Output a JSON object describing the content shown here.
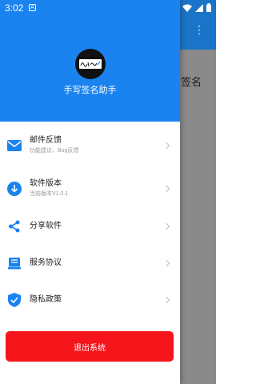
{
  "status_bar": {
    "time": "3:02",
    "app_icon": "A"
  },
  "background": {
    "title": "签名"
  },
  "drawer": {
    "app_name": "手写签名助手",
    "menu": [
      {
        "label": "邮件反馈",
        "sub": "功能建议、Bug反馈",
        "icon": "mail-icon"
      },
      {
        "label": "软件版本",
        "sub": "当前版本V1.0.1",
        "icon": "download-icon"
      },
      {
        "label": "分享软件",
        "sub": "",
        "icon": "share-icon"
      },
      {
        "label": "服务协议",
        "sub": "",
        "icon": "agreement-icon"
      },
      {
        "label": "隐私政策",
        "sub": "",
        "icon": "shield-check-icon"
      }
    ],
    "logout_label": "退出系统"
  },
  "colors": {
    "primary": "#1a83f0",
    "danger": "#f5141a",
    "icon_blue": "#1a83f0"
  }
}
